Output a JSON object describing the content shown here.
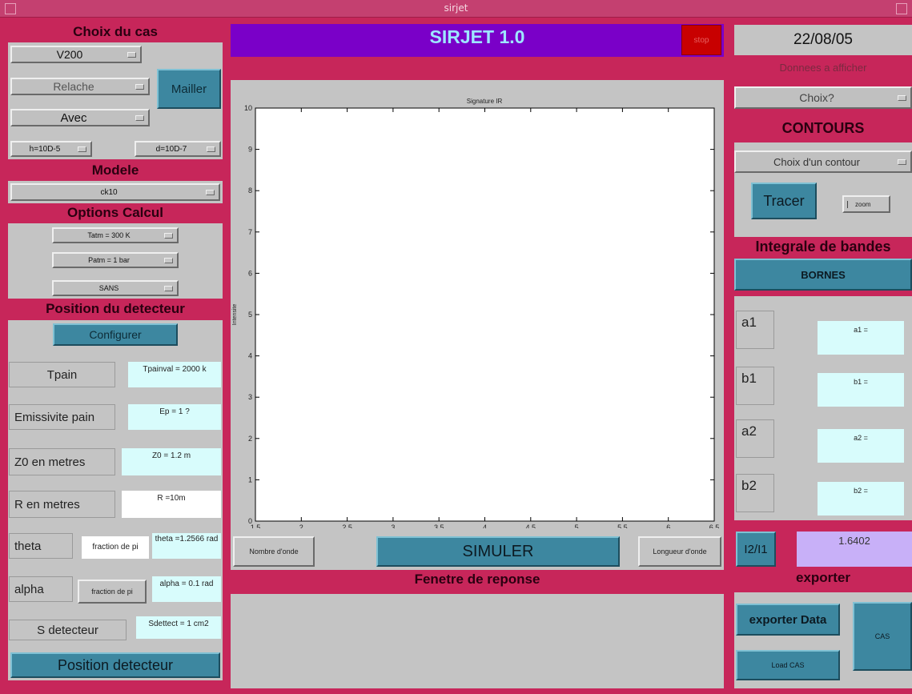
{
  "window": {
    "title": "sirjet"
  },
  "left": {
    "choix_header": "Choix du cas",
    "case_select": "V200",
    "relache_select": "Relache",
    "mailler_button": "Mailler",
    "avec_select": "Avec",
    "h_select": "h=10D-5",
    "d_select": "d=10D-7",
    "modele_header": "Modele",
    "modele_select": "ck10",
    "options_header": "Options Calcul",
    "tatm_select": "Tatm = 300 K",
    "patm_select": "Patm = 1 bar",
    "sans_select": "SANS",
    "position_header": "Position du detecteur",
    "configurer_button": "Configurer",
    "rows": [
      {
        "label": "Tpain",
        "value": "Tpainval = 2000 k"
      },
      {
        "label": "Emissivite pain",
        "value": "Ep = 1 ?"
      },
      {
        "label": "Z0 en metres",
        "value": "Z0 = 1.2 m"
      },
      {
        "label": "R en metres",
        "value": "R =10m"
      },
      {
        "label": "theta",
        "frac": "fraction de pi",
        "value": "theta =1.2566 rad"
      },
      {
        "label": "alpha",
        "frac": "fraction de pi",
        "value": "alpha = 0.1 rad"
      },
      {
        "label": "S detecteur",
        "value": "Sdettect = 1 cm2"
      }
    ],
    "position_detecteur_button": "Position detecteur"
  },
  "center": {
    "app_title": "SIRJET 1.0",
    "stop_button": "stop",
    "nombre_onde_button": "Nombre d'onde",
    "simuler_button": "SIMULER",
    "longueur_onde_button": "Longueur d'onde",
    "fenetre_header": "Fenetre de reponse"
  },
  "chart_data": {
    "type": "line",
    "title": "Signature IR",
    "xlabel": "",
    "ylabel": "Intensite",
    "xlim": [
      1.5,
      6.5
    ],
    "ylim": [
      0,
      10
    ],
    "xticks": [
      "1.5",
      "2",
      "2.5",
      "3",
      "3.5",
      "4",
      "4.5",
      "5",
      "5.5",
      "6",
      "6.5"
    ],
    "yticks": [
      "0",
      "1",
      "2",
      "3",
      "4",
      "5",
      "6",
      "7",
      "8",
      "9",
      "10"
    ],
    "series": []
  },
  "right": {
    "date": "22/08/05",
    "donnees_label": "Donnees a afficher",
    "choix_select": "Choix?",
    "contours_header": "CONTOURS",
    "contour_select": "Choix d'un contour",
    "tracer_button": "Tracer",
    "zoom_checkbox": "zoom",
    "integrale_header": "Integrale de bandes",
    "bornes_button": "BORNES",
    "bounds": [
      {
        "label": "a1",
        "value": "a1 ="
      },
      {
        "label": "b1",
        "value": "b1 ="
      },
      {
        "label": "a2",
        "value": "a2 ="
      },
      {
        "label": "b2",
        "value": "b2 ="
      }
    ],
    "ratio_button": "I2/I1",
    "ratio_value": "1.6402",
    "exporter_header": "exporter",
    "exporter_data_button": "exporter Data",
    "cas_button": "CAS",
    "load_cas_button": "Load CAS"
  }
}
